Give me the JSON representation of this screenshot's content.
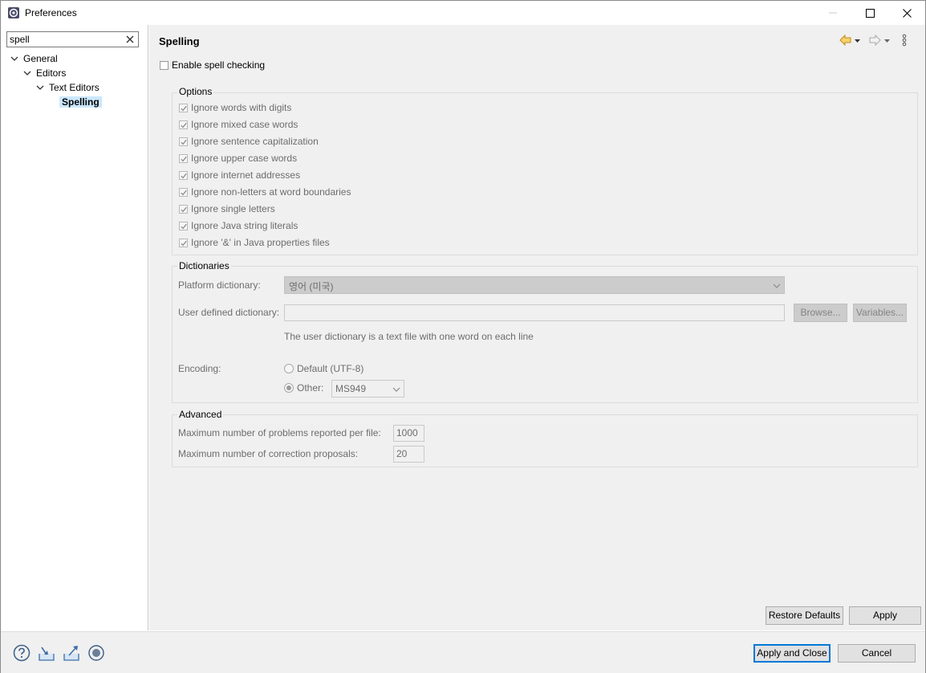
{
  "window": {
    "title": "Preferences",
    "icon": "preferences-app-icon",
    "controls": [
      "minimize-icon",
      "maximize-icon",
      "close-icon"
    ]
  },
  "search": {
    "value": "spell",
    "clear_icon": "clear-icon"
  },
  "tree": [
    {
      "label": "General"
    },
    {
      "label": "Editors"
    },
    {
      "label": "Text Editors"
    },
    {
      "label": "Spelling",
      "selected": true
    }
  ],
  "page": {
    "title": "Spelling"
  },
  "enable": {
    "label": "Enable spell checking",
    "checked": false
  },
  "options": {
    "title": "Options",
    "items": [
      {
        "label": "Ignore words with digits",
        "checked": true
      },
      {
        "label": "Ignore mixed case words",
        "checked": true
      },
      {
        "label": "Ignore sentence capitalization",
        "checked": true
      },
      {
        "label": "Ignore upper case words",
        "checked": true
      },
      {
        "label": "Ignore internet addresses",
        "checked": true
      },
      {
        "label": "Ignore non-letters at word boundaries",
        "checked": true
      },
      {
        "label": "Ignore single letters",
        "checked": true
      },
      {
        "label": "Ignore Java string literals",
        "checked": true
      },
      {
        "label": "Ignore '&' in Java properties files",
        "checked": true
      }
    ]
  },
  "dictionaries": {
    "title": "Dictionaries",
    "platform_label": "Platform dictionary:",
    "platform_value": "영어 (미국)",
    "user_label": "User defined dictionary:",
    "user_value": "",
    "browse": "Browse...",
    "variables": "Variables...",
    "hint": "The user dictionary is a text file with one word on each line",
    "encoding_label": "Encoding:",
    "default_label": "Default (UTF-8)",
    "other_label": "Other:",
    "other_value": "MS949",
    "selected_encoding": "Other"
  },
  "advanced": {
    "title": "Advanced",
    "max_problems_label": "Maximum number of problems reported per file:",
    "max_problems_value": "1000",
    "max_proposals_label": "Maximum number of correction proposals:",
    "max_proposals_value": "20"
  },
  "buttons": {
    "restore": "Restore Defaults",
    "apply": "Apply",
    "apply_close": "Apply and Close",
    "cancel": "Cancel"
  },
  "bottom_icons": [
    "help-icon",
    "import-icon",
    "export-icon",
    "record-icon"
  ]
}
